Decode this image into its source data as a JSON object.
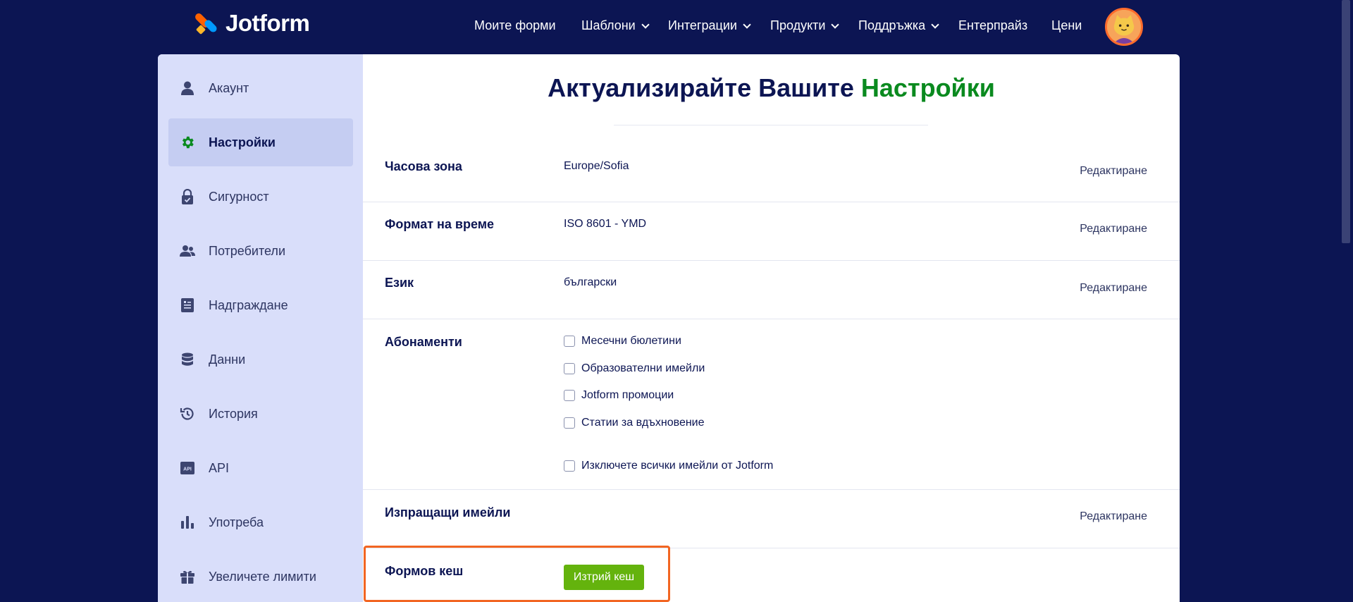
{
  "header": {
    "logo_text": "Jotform",
    "nav": [
      {
        "label": "Моите форми",
        "has_dropdown": false
      },
      {
        "label": "Шаблони",
        "has_dropdown": true
      },
      {
        "label": "Интеграции",
        "has_dropdown": true
      },
      {
        "label": "Продукти",
        "has_dropdown": true
      },
      {
        "label": "Поддръжка",
        "has_dropdown": true
      },
      {
        "label": "Ентерпрайз",
        "has_dropdown": false
      },
      {
        "label": "Цени",
        "has_dropdown": false
      }
    ]
  },
  "sidebar": {
    "items": [
      {
        "label": "Акаунт",
        "icon": "user-icon"
      },
      {
        "label": "Настройки",
        "icon": "gear-icon",
        "active": true
      },
      {
        "label": "Сигурност",
        "icon": "lock-icon"
      },
      {
        "label": "Потребители",
        "icon": "users-icon"
      },
      {
        "label": "Надграждане",
        "icon": "upgrade-icon"
      },
      {
        "label": "Данни",
        "icon": "database-icon"
      },
      {
        "label": "История",
        "icon": "history-icon"
      },
      {
        "label": "API",
        "icon": "api-icon"
      },
      {
        "label": "Употреба",
        "icon": "bar-chart-icon"
      },
      {
        "label": "Увеличете лимити",
        "icon": "gift-icon"
      }
    ]
  },
  "main": {
    "title_prefix": "Актуализирайте Вашите ",
    "title_highlight": "Настройки",
    "edit_label": "Редактиране",
    "rows": {
      "timezone": {
        "label": "Часова зона",
        "value": "Europe/Sofia"
      },
      "time_format": {
        "label": "Формат на време",
        "value": "ISO 8601 - YMD"
      },
      "language": {
        "label": "Език",
        "value": "български"
      },
      "subscriptions": {
        "label": "Абонаменти",
        "options": [
          "Месечни бюлетини",
          "Образователни имейли",
          "Jotform промоции",
          "Статии за вдъхновение"
        ],
        "unsubscribe_all": "Изключете всички имейли от Jotform"
      },
      "sender_emails": {
        "label": "Изпращащи имейли"
      },
      "form_cache": {
        "label": "Формов кеш",
        "button": "Изтрий кеш"
      }
    }
  },
  "colors": {
    "background": "#0c1553",
    "accent_green": "#0a8a1f",
    "button_green": "#64b30d",
    "highlight_orange": "#f26522",
    "sidebar_bg": "#d9defa"
  }
}
